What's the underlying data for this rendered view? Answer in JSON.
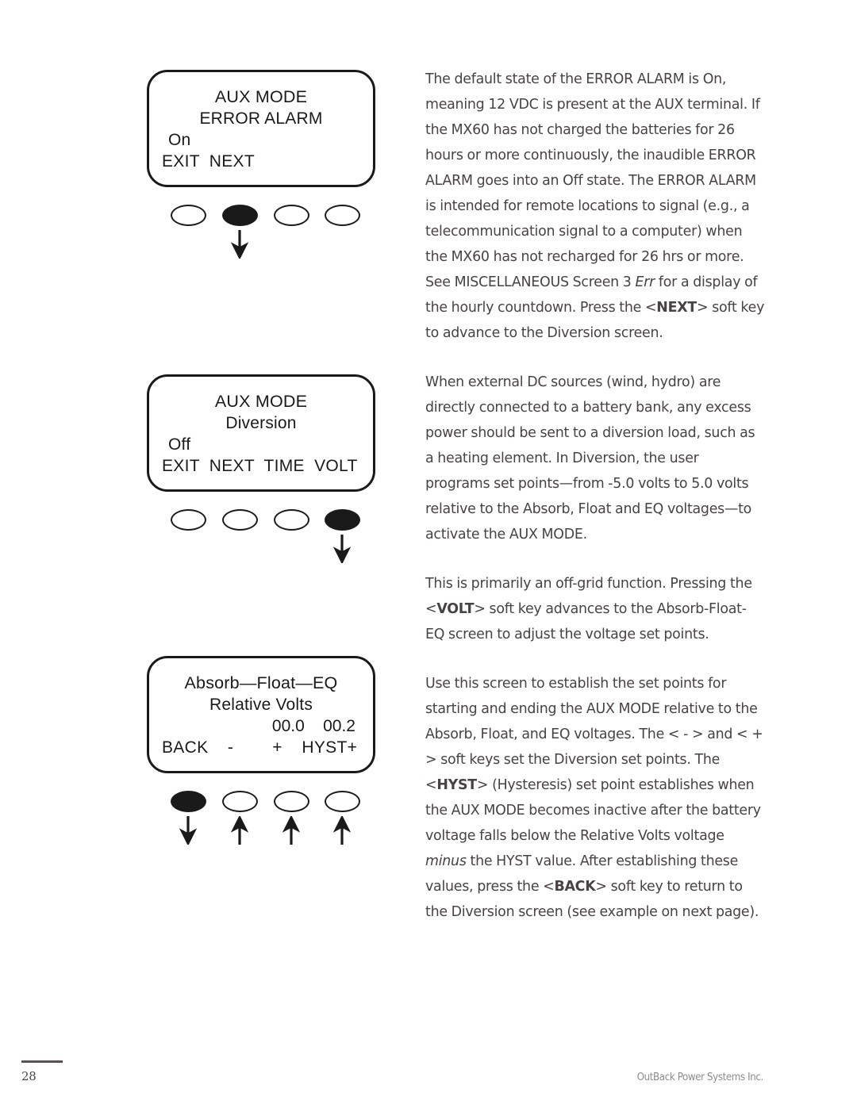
{
  "page": {
    "number": "28",
    "brand": "OutBack Power Systems Inc."
  },
  "figures": [
    {
      "id": "aux-mode-error-alarm",
      "screen": {
        "title": "AUX MODE",
        "subtitle": "ERROR ALARM",
        "status": "On",
        "softkeys_line": "EXIT  NEXT"
      },
      "keys": [
        {
          "label": "EXIT",
          "state": "unpressed"
        },
        {
          "label": "NEXT",
          "state": "pressed"
        },
        {
          "label": "",
          "state": "unpressed"
        },
        {
          "label": "",
          "state": "unpressed"
        }
      ],
      "arrows": [
        {
          "index": 1,
          "direction": "down"
        }
      ]
    },
    {
      "id": "aux-mode-diversion",
      "screen": {
        "title": "AUX MODE",
        "subtitle": "Diversion",
        "status": "Off",
        "softkeys_line": "EXIT  NEXT  TIME  VOLT"
      },
      "keys": [
        {
          "label": "EXIT",
          "state": "unpressed"
        },
        {
          "label": "NEXT",
          "state": "unpressed"
        },
        {
          "label": "TIME",
          "state": "unpressed"
        },
        {
          "label": "VOLT",
          "state": "pressed"
        }
      ],
      "arrows": [
        {
          "index": 3,
          "direction": "down"
        }
      ]
    },
    {
      "id": "absorb-float-eq-relative-volts",
      "screen": {
        "title": "Absorb—Float—EQ",
        "subtitle": "Relative Volts",
        "values_line": "00.0    00.2",
        "value_1": "00.0",
        "value_2": "00.2",
        "softkeys_line": "BACK    -        +    HYST+"
      },
      "keys": [
        {
          "label": "BACK",
          "state": "pressed"
        },
        {
          "label": "-",
          "state": "unpressed"
        },
        {
          "label": "+",
          "state": "unpressed"
        },
        {
          "label": "HYST+",
          "state": "unpressed"
        }
      ],
      "arrows": [
        {
          "index": 0,
          "direction": "down"
        },
        {
          "index": 1,
          "direction": "up"
        },
        {
          "index": 2,
          "direction": "up"
        },
        {
          "index": 3,
          "direction": "up"
        }
      ]
    }
  ],
  "body": {
    "p1_a": "The default state of the ERROR ALARM is On, meaning 12 VDC is present at the AUX terminal. If the MX60 has not charged the batteries for 26 hours or more continuously, the inaudible ERROR ALARM goes into an Off state. The ERROR ALARM is intended for remote locations to signal (e.g., a telecommunication signal to a computer) when the MX60 has not recharged for 26 hrs or more. See MISCELLANEOUS Screen 3 ",
    "p1_err": "Err",
    "p1_b": " for a display of the hourly countdown. Press the <",
    "p1_next": "NEXT",
    "p1_c": "> soft key to advance to the Diversion screen.",
    "p2": "When external DC sources (wind, hydro) are directly connected to a battery bank, any excess power should be sent to a diversion load, such as a heating element. In Diversion, the user programs set points—from -5.0 volts to 5.0 volts relative to the Absorb, Float and EQ voltages—to activate the AUX MODE.",
    "p3_a": "This is primarily an off-grid function. Pressing the <",
    "p3_volt": "VOLT",
    "p3_b": "> soft key advances to the Absorb-Float-EQ screen to adjust the voltage set points.",
    "p4_a": "Use this screen to establish the set points for starting and ending the AUX MODE relative to the Absorb, Float, and EQ voltages. The < - > and < + > soft keys set the Diversion set points. The <",
    "p4_hyst": "HYST",
    "p4_b": "> (Hysteresis) set point establishes when the AUX MODE becomes inactive after the battery voltage falls below the Relative Volts voltage ",
    "p4_minus": "minus",
    "p4_c": " the HYST value. After establishing these values, press the <",
    "p4_back": "BACK",
    "p4_d": "> soft key to return to the Diversion screen (see example on next page)."
  }
}
